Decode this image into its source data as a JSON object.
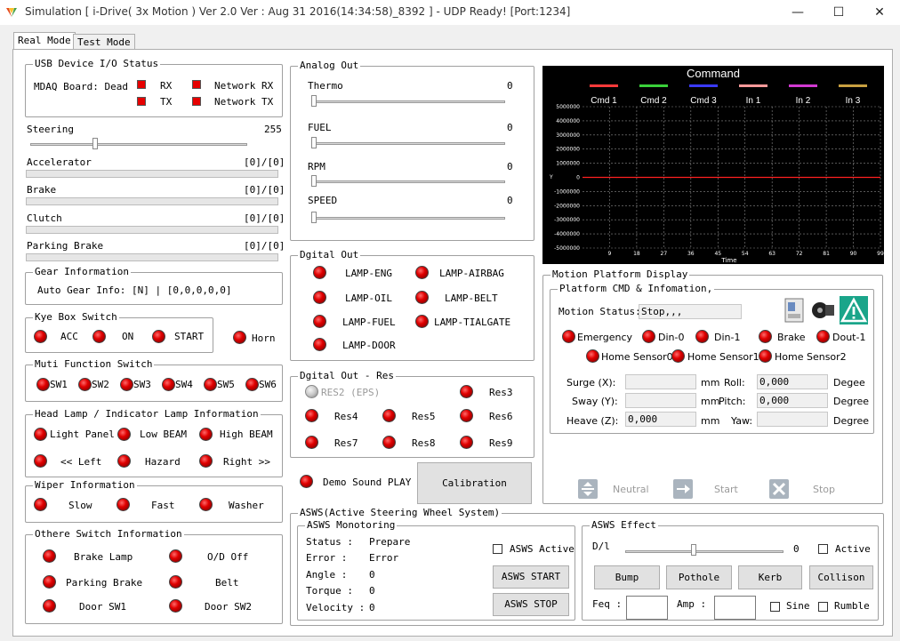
{
  "window": {
    "title": "Simulation [ i-Drive( 3x Motion ) Ver 2.0  Ver : Aug 31 2016(14:34:58)_8392 ] - UDP Ready! [Port:1234]",
    "minimize": "—",
    "maximize": "☐",
    "close": "✕"
  },
  "tabs": [
    "Real Mode",
    "Test Mode"
  ],
  "usb": {
    "title": "USB Device I/O Status",
    "board_label": "MDAQ Board: Dead",
    "rx": "RX",
    "tx": "TX",
    "net_rx": "Network RX",
    "net_tx": "Network TX"
  },
  "steering": {
    "label": "Steering",
    "value": "255",
    "position": 0.3
  },
  "pedals": [
    {
      "label": "Accelerator",
      "value": "[0]/[0]"
    },
    {
      "label": "Brake",
      "value": "[0]/[0]"
    },
    {
      "label": "Clutch",
      "value": "[0]/[0]"
    },
    {
      "label": "Parking Brake",
      "value": "[0]/[0]"
    }
  ],
  "gear": {
    "title": "Gear Information",
    "text": "Auto Gear Info: [N] | [0,0,0,0,0]"
  },
  "keybox": {
    "title": "Kye Box Switch",
    "items": [
      "ACC",
      "ON",
      "START"
    ],
    "horn": "Horn"
  },
  "multi": {
    "title": "Muti Function Switch",
    "items": [
      "SW1",
      "SW2",
      "SW3",
      "SW4",
      "SW5",
      "SW6"
    ]
  },
  "headlamp": {
    "title": "Head Lamp / Indicator Lamp Information",
    "row1": [
      "Light Panel",
      "Low BEAM",
      "High BEAM"
    ],
    "row2": [
      "<< Left",
      "Hazard",
      "Right >>"
    ]
  },
  "wiper": {
    "title": "Wiper Information",
    "items": [
      "Slow",
      "Fast",
      "Washer"
    ]
  },
  "other": {
    "title": "Othere Switch Information",
    "items": [
      "Brake Lamp",
      "O/D Off",
      "Parking Brake",
      "Belt",
      "Door SW1",
      "Door SW2"
    ]
  },
  "analog": {
    "title": "Analog Out",
    "items": [
      {
        "label": "Thermo",
        "value": "0"
      },
      {
        "label": "FUEL",
        "value": "0"
      },
      {
        "label": "RPM",
        "value": "0"
      },
      {
        "label": "SPEED",
        "value": "0"
      }
    ]
  },
  "digital": {
    "title": "Dgital Out",
    "items": [
      "LAMP-ENG",
      "LAMP-AIRBAG",
      "LAMP-OIL",
      "LAMP-BELT",
      "LAMP-FUEL",
      "LAMP-TIALGATE",
      "LAMP-DOOR"
    ]
  },
  "digres": {
    "title": "Dgital Out - Res",
    "res2": "RES2 (EPS)",
    "items": [
      "Res3",
      "Res4",
      "Res5",
      "Res6",
      "Res7",
      "Res8",
      "Res9"
    ]
  },
  "demo_sound": "Demo Sound PLAY",
  "calibration": "Calibration",
  "chart_data": {
    "type": "line",
    "title": "Command",
    "legend": [
      "Cmd 1",
      "Cmd 2",
      "Cmd 3",
      "In 1",
      "In 2",
      "In 3"
    ],
    "legend_colors": [
      "#ff3a3a",
      "#3ad13a",
      "#3a3aff",
      "#ff9a9a",
      "#d23ad2",
      "#c8a040"
    ],
    "y_ticks": [
      "5000000",
      "4000000",
      "3000000",
      "2000000",
      "1000000",
      "0",
      "-1000000",
      "-2000000",
      "-3000000",
      "-4000000",
      "-5000000"
    ],
    "x_ticks": [
      "9",
      "18",
      "27",
      "36",
      "45",
      "54",
      "63",
      "72",
      "81",
      "90",
      "99"
    ],
    "xlabel": "Time",
    "ylabel": "Y",
    "ylim": [
      -5000000,
      5000000
    ],
    "xlim": [
      0,
      99
    ],
    "series": [
      {
        "values": [
          0,
          0
        ]
      }
    ]
  },
  "motion": {
    "title": "Motion Platform Display",
    "cmd_title": "Platform CMD & Infomation,",
    "status_label": "Motion Status:",
    "status_value": "Stop,,,",
    "indicators": [
      "Emergency",
      "Din-0",
      "Din-1",
      "Brake",
      "Dout-1"
    ],
    "home": [
      "Home Sensor0",
      "Home Sensor1",
      "Home Sensor2"
    ],
    "surge": "Surge (X):",
    "sway": "Sway (Y):",
    "heave": "Heave (Z):",
    "mm": "mm",
    "roll": "Roll:",
    "pitch": "Pitch:",
    "yaw": "Yaw:",
    "degee": "Degee",
    "degree": "Degree",
    "roll_val": "0,000",
    "pitch_val": "0,000",
    "heave_val": "0,000",
    "neutral": "Neutral",
    "start": "Start",
    "stop": "Stop"
  },
  "asws": {
    "title": "ASWS(Active Steering Wheel System)",
    "mon_title": "ASWS Monotoring",
    "rows": [
      {
        "label": "Status   :",
        "value": "Prepare"
      },
      {
        "label": "Error    :",
        "value": "Error"
      },
      {
        "label": "Angle    :",
        "value": "0"
      },
      {
        "label": "Torque   :",
        "value": "0"
      },
      {
        "label": "Velocity :",
        "value": "0"
      }
    ],
    "active": "ASWS Active",
    "start": "ASWS START",
    "stop": "ASWS STOP"
  },
  "effect": {
    "title": "ASWS Effect",
    "dl": "D/l",
    "value": "0",
    "position": 0.43,
    "active": "Active",
    "buttons": [
      "Bump",
      "Pothole",
      "Kerb",
      "Collison"
    ],
    "freq": "Feq :",
    "amp": "Amp :",
    "sine": "Sine",
    "rumble": "Rumble"
  }
}
